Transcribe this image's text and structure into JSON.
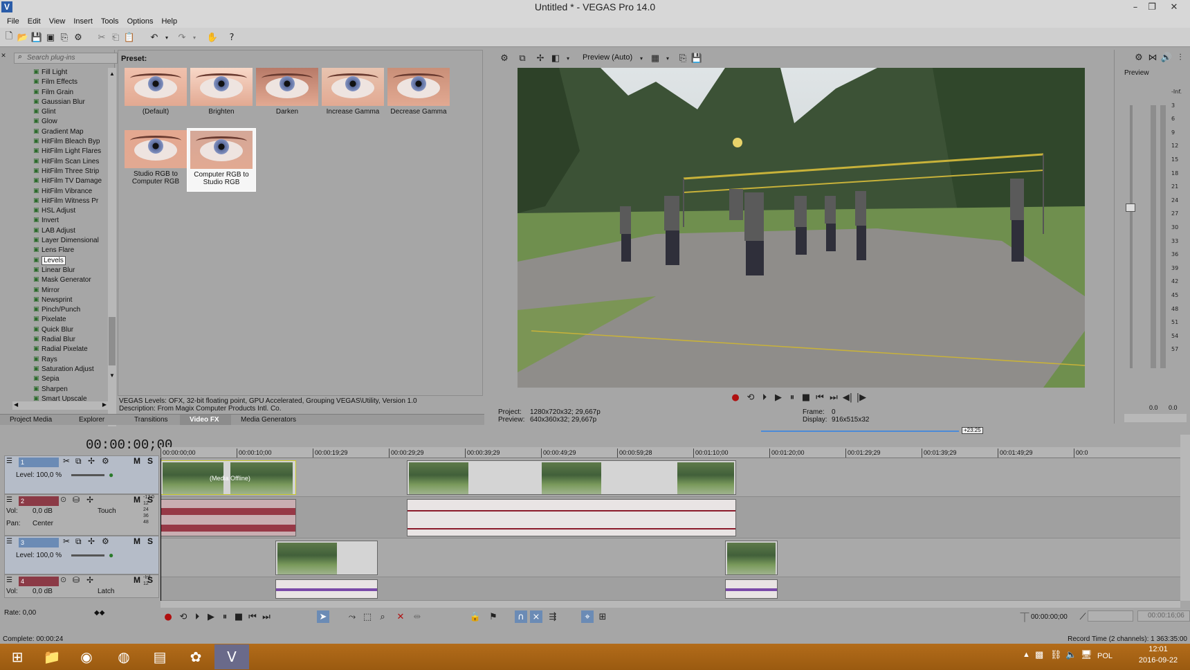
{
  "window": {
    "title": "Untitled * - VEGAS Pro 14.0"
  },
  "menu": [
    "File",
    "Edit",
    "View",
    "Insert",
    "Tools",
    "Options",
    "Help"
  ],
  "plugins": {
    "search_placeholder": "Search plug-ins",
    "items": [
      "Fill Light",
      "Film Effects",
      "Film Grain",
      "Gaussian Blur",
      "Glint",
      "Glow",
      "Gradient Map",
      "HitFilm Bleach Byp",
      "HitFilm Light Flares",
      "HitFilm Scan Lines",
      "HitFilm Three Strip",
      "HitFilm TV Damage",
      "HitFilm Vibrance",
      "HitFilm Witness Pr",
      "HSL Adjust",
      "Invert",
      "LAB Adjust",
      "Layer Dimensional",
      "Lens Flare",
      "Levels",
      "Linear Blur",
      "Mask Generator",
      "Mirror",
      "Newsprint",
      "Pinch/Punch",
      "Pixelate",
      "Quick Blur",
      "Radial Blur",
      "Radial Pixelate",
      "Rays",
      "Saturation Adjust",
      "Sepia",
      "Sharpen",
      "Smart Upscale"
    ],
    "selected": "Levels"
  },
  "presets": {
    "label": "Preset:",
    "items": [
      "(Default)",
      "Brighten",
      "Darken",
      "Increase Gamma",
      "Decrease Gamma",
      "Studio RGB to Computer RGB",
      "Computer RGB to Studio RGB"
    ],
    "selected": "Computer RGB to Studio RGB"
  },
  "description": {
    "line1": "VEGAS Levels: OFX, 32-bit floating point, GPU Accelerated, Grouping VEGAS\\Utility, Version 1.0",
    "line2": "Description: From Magix Computer Products Intl. Co."
  },
  "tabs": [
    "Project Media",
    "Explorer",
    "Transitions",
    "Video FX",
    "Media Generators"
  ],
  "active_tab": "Video FX",
  "preview": {
    "quality": "Preview (Auto)",
    "project_label": "Project:",
    "project_value": "1280x720x32; 29,667p",
    "preview_label": "Preview:",
    "preview_value": "640x360x32; 29,667p",
    "frame_label": "Frame:",
    "frame_value": "0",
    "display_label": "Display:",
    "display_value": "916x515x32"
  },
  "master": {
    "label": "Preview",
    "db_scale": [
      "-Inf.",
      "3",
      "6",
      "9",
      "12",
      "15",
      "18",
      "21",
      "24",
      "27",
      "30",
      "33",
      "36",
      "39",
      "42",
      "45",
      "48",
      "51",
      "54",
      "57"
    ],
    "level_left": "0.0",
    "level_right": "0.0"
  },
  "timeline": {
    "timecode": "00:00:00;00",
    "duration_badge": "+23:25",
    "ruler": [
      "00:00:00;00",
      "00:00:10;00",
      "00:00:19;29",
      "00:00:29;29",
      "00:00:39;29",
      "00:00:49;29",
      "00:00:59;28",
      "00:01:10;00",
      "00:01:20;00",
      "00:01:29;29",
      "00:01:39;29",
      "00:01:49;29",
      "00:0"
    ],
    "tracks": [
      {
        "num": "1",
        "type": "video",
        "level": "Level: 100,0 %"
      },
      {
        "num": "2",
        "type": "audio",
        "vol": "Vol:",
        "vol_value": "0,0 dB",
        "mode": "Touch",
        "pan": "Pan:",
        "pan_value": "Center",
        "meter": [
          "-17.0",
          "12",
          "24",
          "36",
          "48"
        ]
      },
      {
        "num": "3",
        "type": "video",
        "level": "Level: 100,0 %"
      },
      {
        "num": "4",
        "type": "audio",
        "vol": "Vol:",
        "vol_value": "0,0 dB",
        "mode": "Latch",
        "meter": [
          "-Inf.",
          "12"
        ]
      }
    ],
    "offline_label": "(Media Offline)",
    "rate": "Rate: 0,00",
    "cursor_time": "00:00:00;00",
    "end_time": "00:00:16;06"
  },
  "status": {
    "left": "Complete: 00:00:24",
    "right": "Record Time (2 channels): 1 363:35:00"
  },
  "taskbar": {
    "lang": "POL",
    "time": "12:01",
    "date": "2016-09-22"
  }
}
